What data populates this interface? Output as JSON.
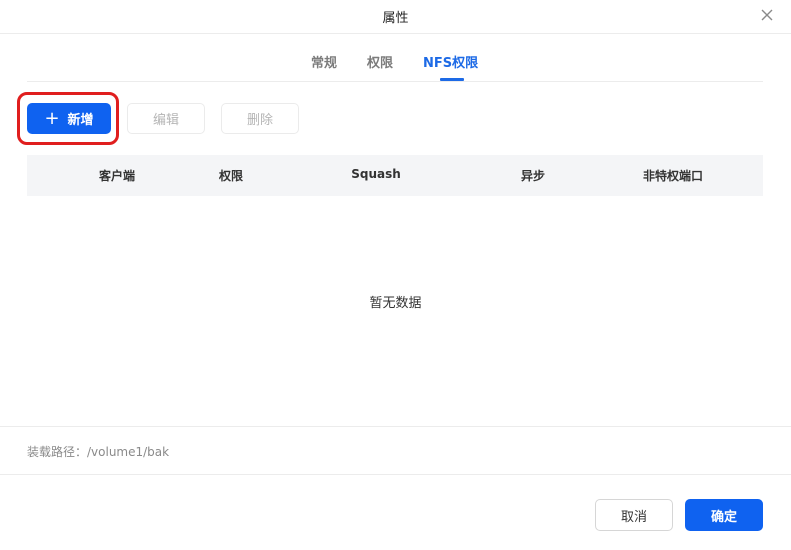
{
  "dialog": {
    "title": "属性",
    "close_icon": "close-icon"
  },
  "tabs": [
    {
      "label": "常规",
      "active": false
    },
    {
      "label": "权限",
      "active": false
    },
    {
      "label": "NFS权限",
      "active": true
    }
  ],
  "toolbar": {
    "add_label": "新增",
    "add_icon": "plus-icon",
    "edit_label": "编辑",
    "delete_label": "删除"
  },
  "table": {
    "columns": [
      "客户端",
      "权限",
      "Squash",
      "异步",
      "非特权端口"
    ],
    "rows": [],
    "empty_text": "暂无数据"
  },
  "footer": {
    "mount_path": "装载路径：/volume1/bak",
    "cancel_label": "取消",
    "ok_label": "确定"
  },
  "colors": {
    "primary": "#0f62f0",
    "active_tab": "#1d6ae6",
    "highlight": "#e01e1e"
  }
}
